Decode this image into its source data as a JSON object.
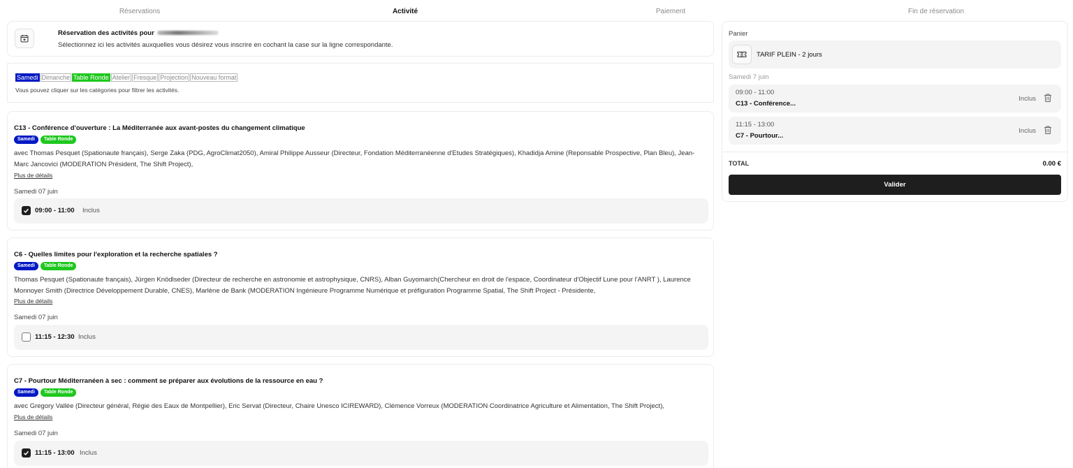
{
  "steps": [
    {
      "label": "Réservations",
      "active": false
    },
    {
      "label": "Activité",
      "active": true
    },
    {
      "label": "Paiement",
      "active": false
    },
    {
      "label": "Fin de réservation",
      "active": false
    }
  ],
  "intro": {
    "icon": "calendar-plus-icon",
    "title": "Réservation des activités pour",
    "subtitle": "Sélectionnez ici les activités auxquelles vous désirez vous inscrire en cochant la case sur la ligne correspondante."
  },
  "filters": {
    "chips": [
      {
        "label": "Samedi",
        "state": "blue"
      },
      {
        "label": "Dimanche",
        "state": "off"
      },
      {
        "label": "Table Ronde",
        "state": "green"
      },
      {
        "label": "Atelier",
        "state": "off"
      },
      {
        "label": "Fresque",
        "state": "off"
      },
      {
        "label": "Projection",
        "state": "off"
      },
      {
        "label": "Nouveau format",
        "state": "off"
      }
    ],
    "hint": "Vous pouvez cliquer sur les catégories pour filtrer les activités.",
    "colors": {
      "blue": "#0018c4",
      "green": "#1ec81e"
    }
  },
  "activities": [
    {
      "title": "C13 - Conférence d'ouverture : La Méditerranée aux avant-postes du changement climatique",
      "tags": [
        "Samedi",
        "Table Ronde"
      ],
      "speakers": "avec Thomas Pesquet (Spationaute français), Serge Zaka (PDG, AgroClimat2050), Amiral Philippe Ausseur (Directeur, Fondation Méditerranéenne d'Etudes Stratégiques), Khadidja Amine (Reponsable Prospective, Plan Bleu), Jean-Marc Jancovici (MODERATION Président, The Shift Project),",
      "details_label": "Plus de détails",
      "date": "Samedi 07 juin",
      "slot_time": "09:00 - 11:00",
      "slot_price": "Inclus",
      "checked": true
    },
    {
      "title": "C6 - Quelles limites pour l'exploration et la recherche spatiales ?",
      "tags": [
        "Samedi",
        "Table Ronde"
      ],
      "speakers": "Thomas Pesquet (Spationaute français), Jürgen Knödlseder (Directeur de recherche en astronomie et astrophysique, CNRS), Alban Guyomarch(Chercheur en droit de l'espace, Coordinateur d'Objectif Lune pour l'ANRT ), Laurence Monnoyer Smith (Directrice Développement Durable, CNES), Marlène de Bank (MODERATION Ingénieure Programme Numérique et préfiguration Programme Spatial, The Shift Project - Présidente,",
      "details_label": "Plus de détails",
      "date": "Samedi 07 juin",
      "slot_time": "11:15 - 12:30",
      "slot_price": "Inclus",
      "checked": false
    },
    {
      "title": "C7 - Pourtour Méditerranéen à sec : comment se préparer aux évolutions de la ressource en eau ?",
      "tags": [
        "Samedi",
        "Table Ronde"
      ],
      "speakers": "avec Gregory Vallée (Directeur général, Régie des Eaux de Montpellier), Eric Servat (Directeur, Chaire Unesco ICIREWARD), Clémence Vorreux (MODERATION Coordinatrice Agriculture et Alimentation, The Shift Project),",
      "details_label": "Plus de détails",
      "date": "Samedi 07 juin",
      "slot_time": "11:15 - 13:00",
      "slot_price": "Inclus",
      "checked": true
    }
  ],
  "cart": {
    "title": "Panier",
    "tarif_icon": "ticket-icon",
    "tarif": "TARIF PLEIN - 2 jours",
    "day": "Samedi 7 juin",
    "items": [
      {
        "time": "09:00 - 11:00",
        "name": "C13 - Conférence...",
        "price": "Inclus"
      },
      {
        "time": "11:15 - 13:00",
        "name": "C7 - Pourtour...",
        "price": "Inclus"
      }
    ],
    "total_label": "TOTAL",
    "total_value": "0.00 €",
    "validate_label": "Valider"
  }
}
